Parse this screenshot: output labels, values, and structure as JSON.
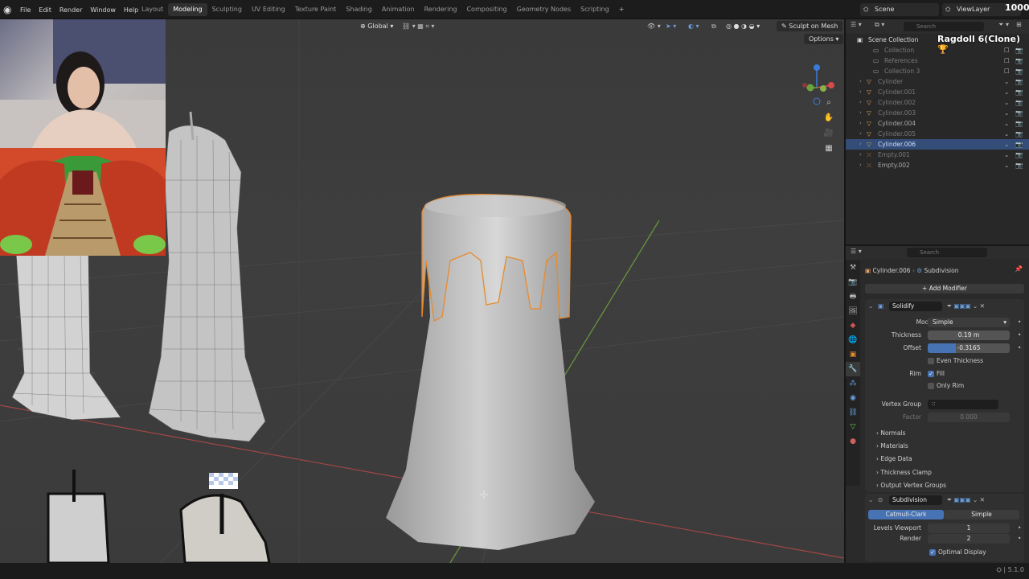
{
  "topbar": {
    "menu": [
      "File",
      "Edit",
      "Render",
      "Window",
      "Help"
    ],
    "workspaces": [
      "Layout",
      "Modeling",
      "Sculpting",
      "UV Editing",
      "Texture Paint",
      "Shading",
      "Animation",
      "Rendering",
      "Compositing",
      "Geometry Nodes",
      "Scripting"
    ],
    "active_workspace": "Modeling",
    "scene": "Scene",
    "view_layer": "ViewLayer"
  },
  "viewport_header": {
    "orientation": "Global",
    "sculpt_button": "Sculpt on Mesh",
    "options": "Options"
  },
  "outliner": {
    "search_placeholder": "Search",
    "root": "Scene Collection",
    "items": [
      {
        "name": "Collection",
        "dim": true
      },
      {
        "name": "References",
        "dim": true
      },
      {
        "name": "Collection 3",
        "dim": true
      },
      {
        "name": "Cylinder",
        "dim": true
      },
      {
        "name": "Cylinder.001",
        "dim": true
      },
      {
        "name": "Cylinder.002",
        "dim": true
      },
      {
        "name": "Cylinder.003",
        "dim": true
      },
      {
        "name": "Cylinder.004",
        "dim": false
      },
      {
        "name": "Cylinder.005",
        "dim": true
      },
      {
        "name": "Cylinder.006",
        "dim": false,
        "selected": true
      },
      {
        "name": "Empty.001",
        "dim": true
      },
      {
        "name": "Empty.002",
        "dim": false
      }
    ]
  },
  "overlay": {
    "ragdoll": "Ragdoll 6(Clone)",
    "score": "1000"
  },
  "properties": {
    "search_placeholder": "Search",
    "object": "Cylinder.006",
    "modifier_context": "Subdivision",
    "add_modifier": "Add Modifier",
    "solidify": {
      "name": "Solidify",
      "mode_label": "Mode",
      "mode": "Simple",
      "thickness_label": "Thickness",
      "thickness": "0.19 m",
      "offset_label": "Offset",
      "offset": "-0.3165",
      "offset_fraction": 0.34,
      "even_thickness": "Even Thickness",
      "rim_label": "Rim",
      "fill": "Fill",
      "only_rim": "Only Rim",
      "vertex_group_label": "Vertex Group",
      "factor_label": "Factor",
      "factor": "0.000",
      "subpanels": [
        "Normals",
        "Materials",
        "Edge Data",
        "Thickness Clamp",
        "Output Vertex Groups"
      ]
    },
    "subdivision": {
      "name": "Subdivision",
      "tab_active": "Catmull-Clark",
      "tab_other": "Simple",
      "levels_viewport_label": "Levels Viewport",
      "levels_viewport": "1",
      "render_label": "Render",
      "render": "2",
      "optimal_display": "Optimal Display"
    }
  },
  "statusbar": {
    "version": "5.1.0"
  },
  "colors": {
    "accent": "#4772b3",
    "selection": "#e88a2c",
    "selected_row": "#334c78"
  }
}
